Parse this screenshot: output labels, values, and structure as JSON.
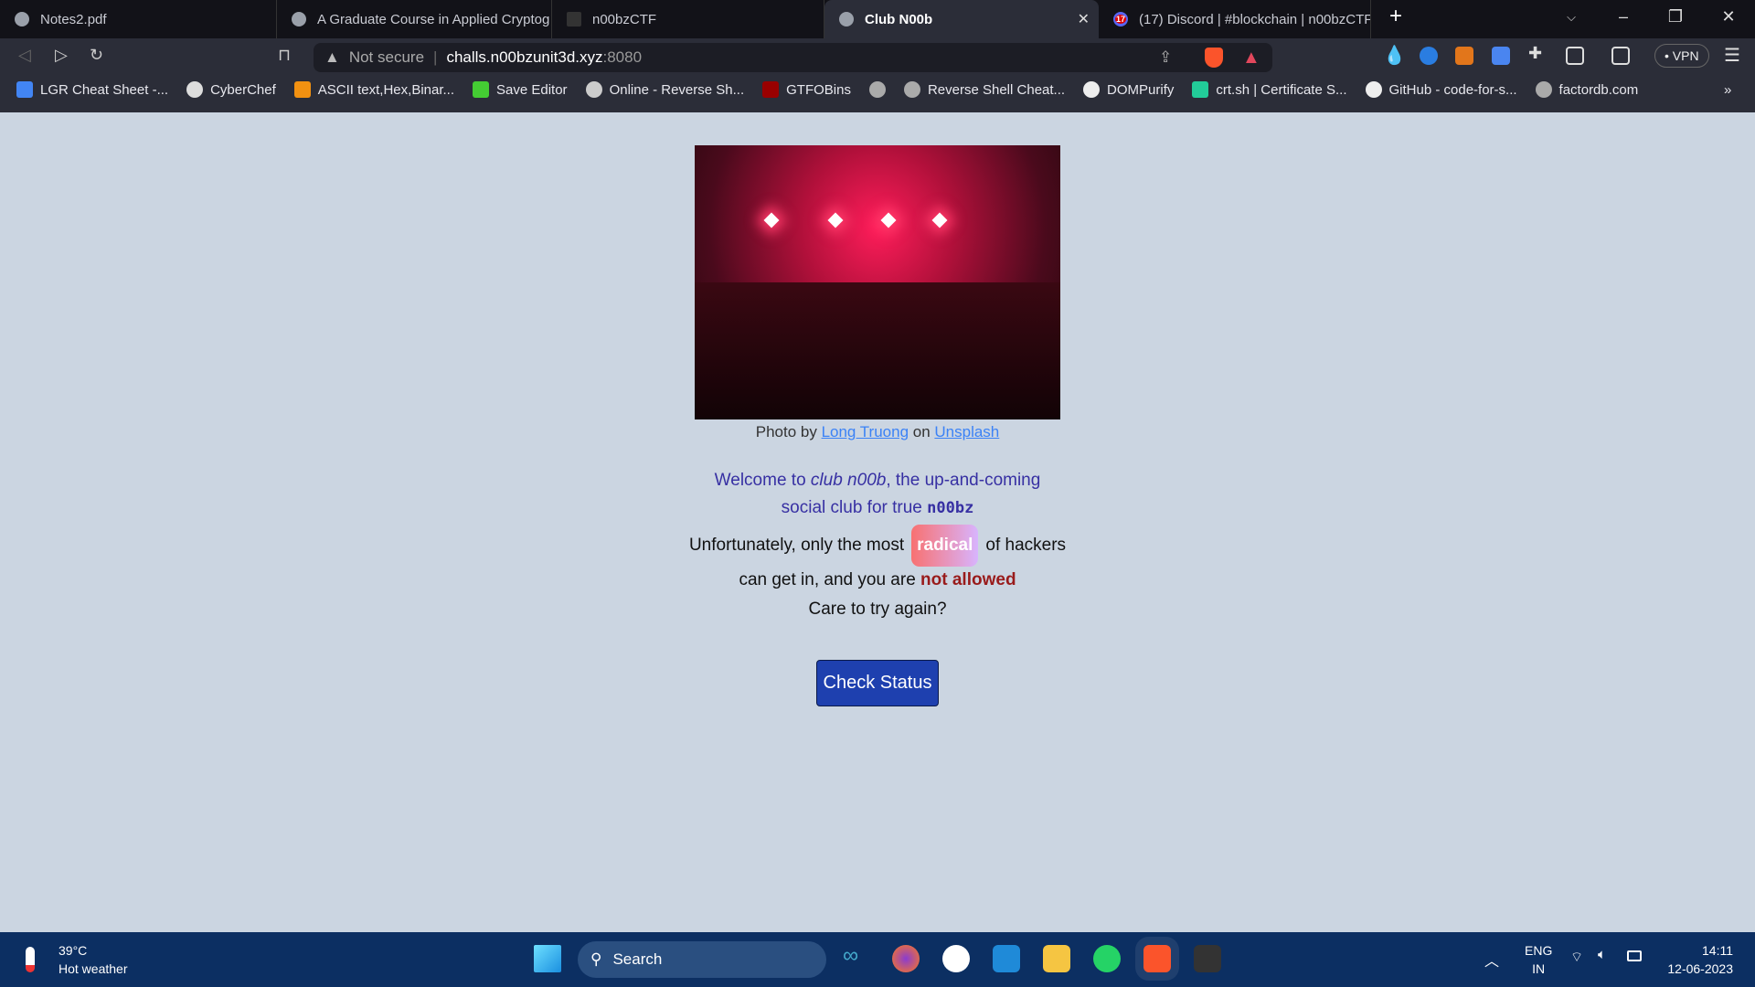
{
  "browser": {
    "tabs": [
      {
        "label": "Notes2.pdf"
      },
      {
        "label": "A Graduate Course in Applied Cryptog"
      },
      {
        "label": "n00bzCTF"
      },
      {
        "label": "Club N00b",
        "active": true
      },
      {
        "label": "(17) Discord | #blockchain | n00bzCTF",
        "badge": "17"
      }
    ],
    "new_tab": "+",
    "address": {
      "security": "Not secure",
      "host": "challs.n00bzunit3d.xyz",
      "port": ":8080"
    },
    "vpn": "VPN",
    "bookmarks": [
      "LGR Cheat Sheet -...",
      "CyberChef",
      "ASCII text,Hex,Binar...",
      "Save Editor",
      "Online - Reverse Sh...",
      "GTFOBins",
      "",
      "Reverse Shell Cheat...",
      "DOMPurify",
      "crt.sh | Certificate S...",
      "GitHub - code-for-s...",
      "factordb.com"
    ],
    "more": "»"
  },
  "page": {
    "caption": {
      "prefix": "Photo by ",
      "author": "Long Truong",
      "mid": " on ",
      "site": "Unsplash"
    },
    "welcome": {
      "a": "Welcome to ",
      "club": "club n00b",
      "b": ", the up-and-coming social club for true ",
      "noobz": "n00bz"
    },
    "unfortunately": {
      "a": "Unfortunately, only the most",
      "radical": "radical",
      "b": "of hackers can get in, and you are ",
      "not_allowed": "not allowed"
    },
    "care": "Care to try again?",
    "button": "Check Status"
  },
  "taskbar": {
    "temp": "39°C",
    "weather": "Hot weather",
    "search": "Search",
    "lang1": "ENG",
    "lang2": "IN",
    "time": "14:11",
    "date": "12-06-2023"
  },
  "colors": {
    "page_bg": "#cbd5e1",
    "welcome": "#3730a3",
    "button": "#1e40af",
    "not_allowed": "#991b1b"
  }
}
